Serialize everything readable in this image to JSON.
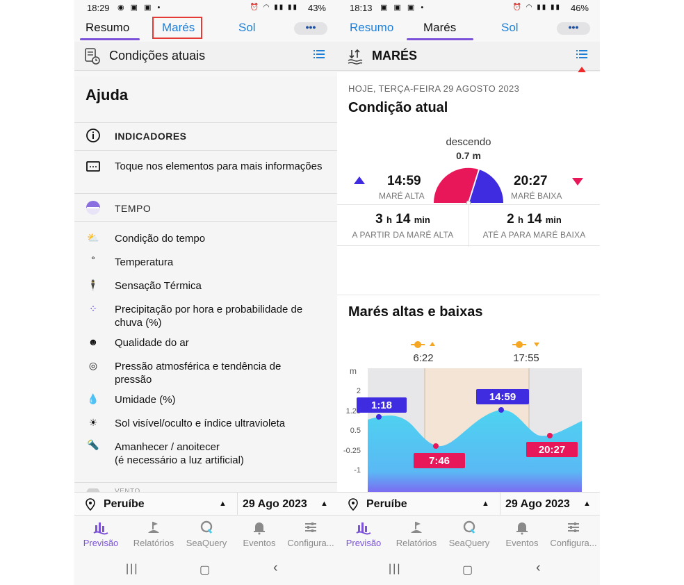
{
  "left": {
    "status": {
      "time": "18:29",
      "battery": "43%"
    },
    "tabs": {
      "resumo": "Resumo",
      "mares": "Marés",
      "sol": "Sol",
      "more": "•••"
    },
    "header": {
      "title": "Condições atuais"
    },
    "help": {
      "title": "Ajuda",
      "indicadores": "INDICADORES",
      "toque": "Toque nos elementos para mais informações",
      "tempo": "TEMPO",
      "items": [
        "Condição do tempo",
        "Temperatura",
        "Sensação Térmica",
        "Precipitação por hora e probabilidade de chuva (%)",
        "Qualidade do ar",
        "Pressão atmosférica e tendência de pressão",
        "Umidade (%)",
        "Sol visível/oculto e índice ultravioleta",
        "Amanhecer / anoitecer",
        "(é necessário a luz artificial)"
      ],
      "next_partial": "VENTO"
    },
    "location": "Peruíbe",
    "date": "29 Ago 2023"
  },
  "right": {
    "status": {
      "time": "18:13",
      "battery": "46%"
    },
    "tabs": {
      "resumo": "Resumo",
      "mares": "Marés",
      "sol": "Sol",
      "more": "•••"
    },
    "header": {
      "title": "MARÉS"
    },
    "date_line": "HOJE, TERÇA-FEIRA 29 AGOSTO 2023",
    "condition_title": "Condição atual",
    "trend": {
      "label": "descendo",
      "value": "0.7 m"
    },
    "high": {
      "time": "14:59",
      "label": "MARÉ ALTA"
    },
    "low": {
      "time": "20:27",
      "label": "MARÉ BAIXA"
    },
    "since_high": {
      "h": "3",
      "h_unit": "h",
      "min": "14",
      "min_unit": "min",
      "label": "A PARTIR DA MARÉ ALTA"
    },
    "until_low": {
      "h": "2",
      "h_unit": "h",
      "min": "14",
      "min_unit": "min",
      "label": "ATÉ A PARA MARÉ BAIXA"
    },
    "highs_title": "Marés altas e baixas",
    "sunrise": "6:22",
    "sunset": "17:55",
    "axis_unit": "m",
    "ticks": [
      "2",
      "1.25",
      "0.5",
      "-0.25",
      "-1"
    ],
    "tide_points": [
      {
        "time": "1:18",
        "type": "high"
      },
      {
        "time": "7:46",
        "type": "low"
      },
      {
        "time": "14:59",
        "type": "high"
      },
      {
        "time": "20:27",
        "type": "low"
      }
    ],
    "location": "Peruíbe",
    "date": "29 Ago 2023"
  },
  "nav": [
    "Previsão",
    "Relatórios",
    "SeaQuery",
    "Eventos",
    "Configura..."
  ],
  "colors": {
    "accent": "#7b52d8",
    "link": "#1f7fd6",
    "high": "#3f2be0",
    "low": "#e8175a",
    "water": "#4cc9ee",
    "alert": "#e53935"
  }
}
